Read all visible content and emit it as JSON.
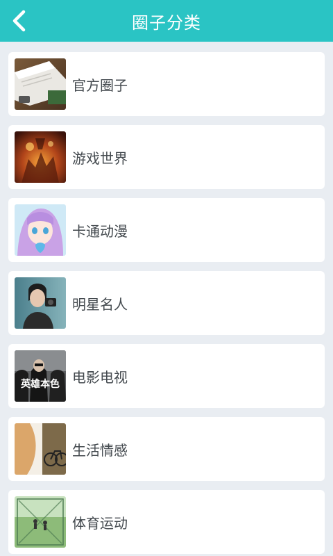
{
  "header": {
    "title": "圈子分类",
    "back_icon": "chevron-left-icon",
    "background": "#2ac4c4"
  },
  "categories": [
    {
      "label": "官方圈子",
      "image": "notebook-photo"
    },
    {
      "label": "游戏世界",
      "image": "fantasy-fire-art"
    },
    {
      "label": "卡通动漫",
      "image": "anime-girl-art"
    },
    {
      "label": "明星名人",
      "image": "celebrity-photo"
    },
    {
      "label": "电影电视",
      "image": "movie-poster",
      "image_text": "英雄本色"
    },
    {
      "label": "生活情感",
      "image": "bicycle-page-curl"
    },
    {
      "label": "体育运动",
      "image": "soccer-field-photo"
    }
  ]
}
